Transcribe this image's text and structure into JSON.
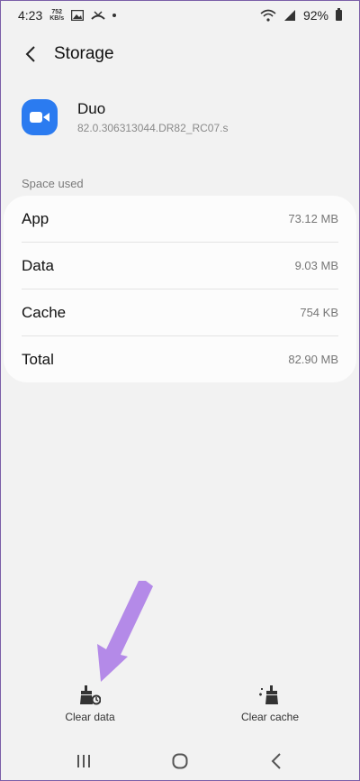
{
  "status_bar": {
    "time": "4:23",
    "net_speed_value": "752",
    "net_speed_unit": "KB/s",
    "battery_percent": "92%"
  },
  "app_bar": {
    "title": "Storage"
  },
  "app_info": {
    "name": "Duo",
    "version": "82.0.306313044.DR82_RC07.s",
    "icon": "video-camera-icon",
    "icon_color": "#2b7bf0"
  },
  "space_used": {
    "label": "Space used",
    "rows": [
      {
        "label": "App",
        "value": "73.12 MB"
      },
      {
        "label": "Data",
        "value": "9.03 MB"
      },
      {
        "label": "Cache",
        "value": "754 KB"
      },
      {
        "label": "Total",
        "value": "82.90 MB"
      }
    ]
  },
  "actions": {
    "clear_data": {
      "label": "Clear data",
      "icon": "clear-data-icon"
    },
    "clear_cache": {
      "label": "Clear cache",
      "icon": "clear-cache-icon"
    }
  },
  "nav": {
    "recents_icon": "recents-icon",
    "home_icon": "home-icon",
    "back_icon": "back-icon"
  },
  "colors": {
    "background": "#f2f2f2",
    "card": "#fcfcfc",
    "accent_arrow": "#b48ae8"
  }
}
